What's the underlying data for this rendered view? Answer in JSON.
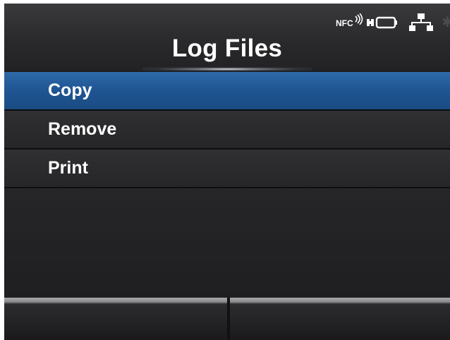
{
  "header": {
    "title": "Log Files",
    "status": {
      "nfc_label": "NFC",
      "icons": [
        "nfc-icon",
        "battery-icon",
        "network-icon",
        "bluetooth-icon"
      ]
    }
  },
  "menu": {
    "items": [
      {
        "label": "Copy",
        "selected": true
      },
      {
        "label": "Remove",
        "selected": false
      },
      {
        "label": "Print",
        "selected": false
      }
    ]
  },
  "softkeys": {
    "left_label": "",
    "right_label": ""
  },
  "colors": {
    "background": "#1c1c1e",
    "selected_item": "#1f5592",
    "text": "#ffffff"
  }
}
